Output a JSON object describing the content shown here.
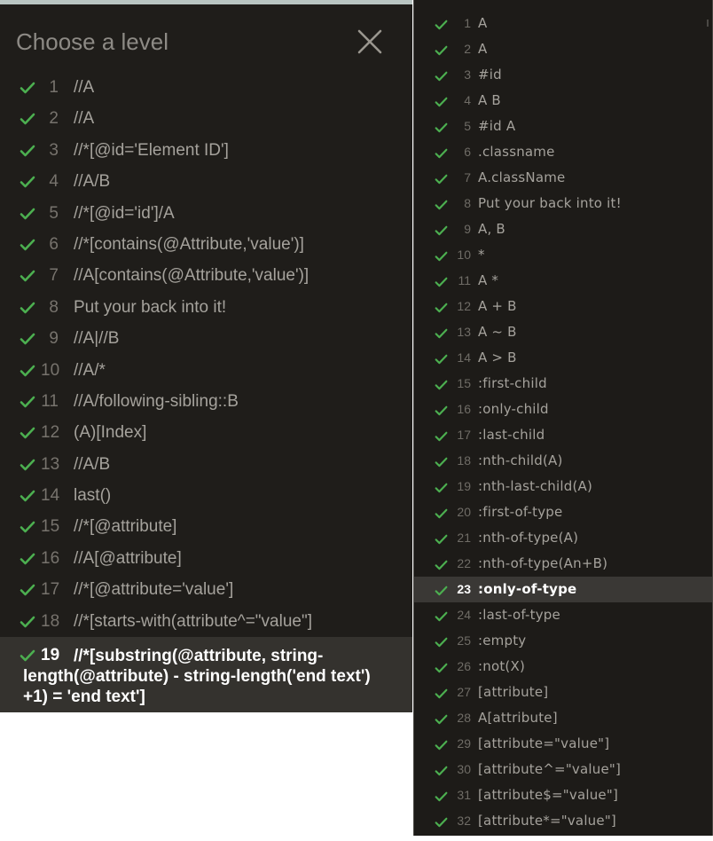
{
  "left_panel": {
    "title": "Choose a level",
    "levels": [
      {
        "num": "1",
        "text": "//A",
        "completed": true
      },
      {
        "num": "2",
        "text": "//A",
        "completed": true
      },
      {
        "num": "3",
        "text": "//*[@id='Element ID']",
        "completed": true
      },
      {
        "num": "4",
        "text": "//A/B",
        "completed": true
      },
      {
        "num": "5",
        "text": "//*[@id='id']/A",
        "completed": true
      },
      {
        "num": "6",
        "text": "//*[contains(@Attribute,'value')]",
        "completed": true
      },
      {
        "num": "7",
        "text": "//A[contains(@Attribute,'value')]",
        "completed": true
      },
      {
        "num": "8",
        "text": "Put your back into it!",
        "completed": true
      },
      {
        "num": "9",
        "text": "//A|//B",
        "completed": true
      },
      {
        "num": "10",
        "text": "//A/*",
        "completed": true
      },
      {
        "num": "11",
        "text": "//A/following-sibling::B",
        "completed": true
      },
      {
        "num": "12",
        "text": "(A)[Index]",
        "completed": true
      },
      {
        "num": "13",
        "text": "//A/B",
        "completed": true
      },
      {
        "num": "14",
        "text": "last()",
        "completed": true
      },
      {
        "num": "15",
        "text": "//*[@attribute]",
        "completed": true
      },
      {
        "num": "16",
        "text": "//A[@attribute]",
        "completed": true
      },
      {
        "num": "17",
        "text": "//*[@attribute='value']",
        "completed": true
      },
      {
        "num": "18",
        "text": "//*[starts-with(attribute^=\"value\"]",
        "completed": true
      },
      {
        "num": "19",
        "text": "//*[substring(@attribute, string-length(@attribute) - string-length('end text') +1) = 'end text']",
        "completed": true,
        "active": true
      }
    ]
  },
  "right_panel": {
    "levels": [
      {
        "num": "1",
        "text": "A"
      },
      {
        "num": "2",
        "text": "A"
      },
      {
        "num": "3",
        "text": "#id"
      },
      {
        "num": "4",
        "text": "A  B"
      },
      {
        "num": "5",
        "text": "#id  A"
      },
      {
        "num": "6",
        "text": ".classname"
      },
      {
        "num": "7",
        "text": "A.className"
      },
      {
        "num": "8",
        "text": "Put your back into it!"
      },
      {
        "num": "9",
        "text": "A, B"
      },
      {
        "num": "10",
        "text": "*"
      },
      {
        "num": "11",
        "text": "A  *"
      },
      {
        "num": "12",
        "text": "A + B"
      },
      {
        "num": "13",
        "text": "A ~ B"
      },
      {
        "num": "14",
        "text": "A > B"
      },
      {
        "num": "15",
        "text": ":first-child"
      },
      {
        "num": "16",
        "text": ":only-child"
      },
      {
        "num": "17",
        "text": ":last-child"
      },
      {
        "num": "18",
        "text": ":nth-child(A)"
      },
      {
        "num": "19",
        "text": ":nth-last-child(A)"
      },
      {
        "num": "20",
        "text": ":first-of-type"
      },
      {
        "num": "21",
        "text": ":nth-of-type(A)"
      },
      {
        "num": "22",
        "text": ":nth-of-type(An+B)"
      },
      {
        "num": "23",
        "text": ":only-of-type",
        "active": true
      },
      {
        "num": "24",
        "text": ":last-of-type"
      },
      {
        "num": "25",
        "text": ":empty"
      },
      {
        "num": "26",
        "text": ":not(X)"
      },
      {
        "num": "27",
        "text": "[attribute]"
      },
      {
        "num": "28",
        "text": "A[attribute]"
      },
      {
        "num": "29",
        "text": "[attribute=\"value\"]"
      },
      {
        "num": "30",
        "text": "[attribute^=\"value\"]"
      },
      {
        "num": "31",
        "text": "[attribute$=\"value\"]"
      },
      {
        "num": "32",
        "text": "[attribute*=\"value\"]"
      }
    ]
  },
  "icons": {
    "check": "check-icon",
    "close": "close-icon"
  },
  "colors": {
    "check_green": "#4caf50",
    "panel_bg": "#1f1d1a",
    "active_row_bg": "#34322e"
  }
}
